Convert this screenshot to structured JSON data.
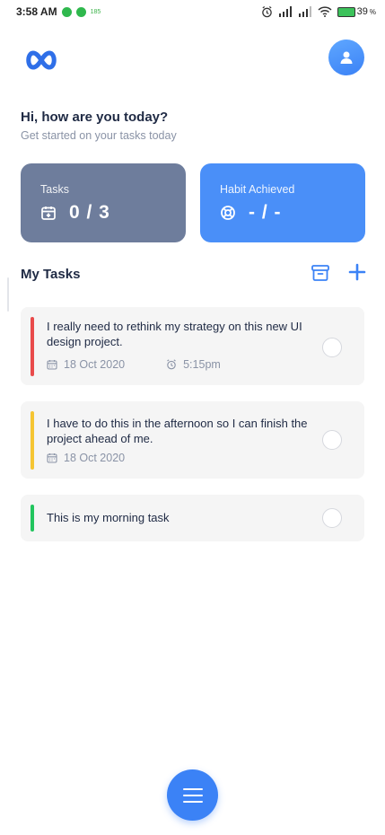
{
  "status_bar": {
    "time": "3:58 AM",
    "mini_label": "185",
    "battery_percent": "39",
    "percent_sign": "%"
  },
  "header": {
    "logo_icon": "infinity-logo-icon",
    "avatar_icon": "user-icon"
  },
  "greeting": {
    "title": "Hi, how are you today?",
    "subtitle": "Get started on your tasks today"
  },
  "cards": {
    "tasks": {
      "label": "Tasks",
      "value": "0 / 3",
      "icon": "calendar-add-icon",
      "color": "#6e7d9c"
    },
    "habit": {
      "label": "Habit Achieved",
      "value": "- / -",
      "icon": "lifebuoy-icon",
      "color": "#4a8ff8"
    }
  },
  "my_tasks": {
    "title": "My Tasks",
    "archive_icon": "archive-icon",
    "add_icon": "plus-icon",
    "items": [
      {
        "text": "I really need to rethink my strategy on this new UI design project.",
        "date": "18 Oct 2020",
        "time": "5:15pm",
        "color": "#e94b4b"
      },
      {
        "text": "I have to do this in the afternoon so I can finish the project ahead of me.",
        "date": "18 Oct 2020",
        "color": "#f5c533"
      },
      {
        "text": "This is my morning task",
        "color": "#22c55e"
      }
    ]
  },
  "fab": {
    "icon": "menu-icon",
    "color": "#3b82f6"
  }
}
